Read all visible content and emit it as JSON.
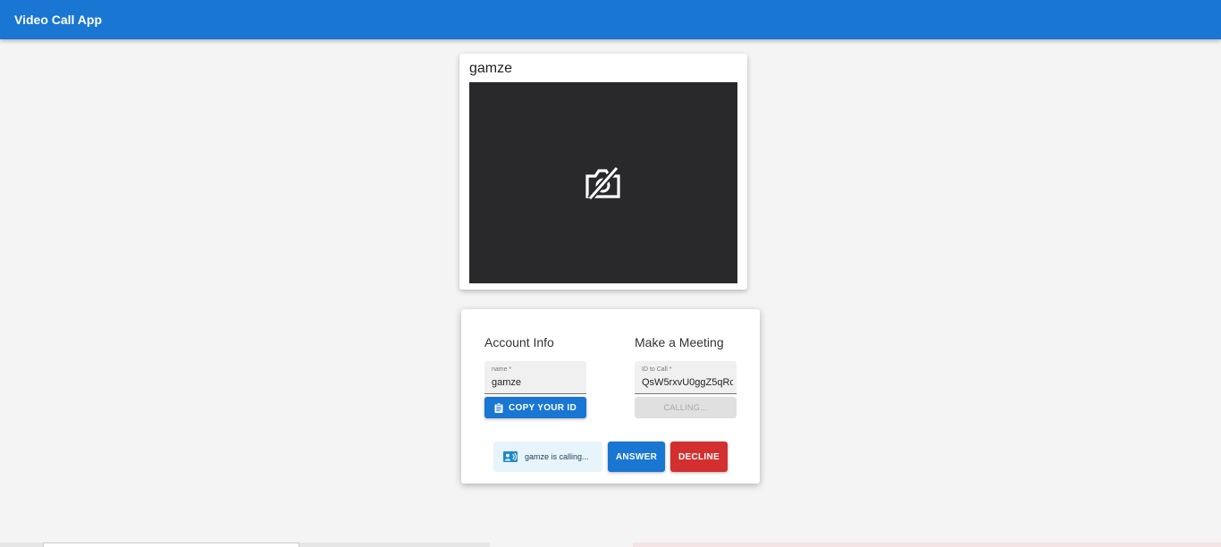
{
  "appbar": {
    "title": "Video Call App",
    "color": "#1976d2"
  },
  "video": {
    "name": "gamze",
    "camera_icon": "videocam-off-icon"
  },
  "account": {
    "title": "Account Info",
    "name_label": "name *",
    "name_value": "gamze",
    "copy_label": "COPY YOUR ID",
    "copy_icon": "clipboard-icon"
  },
  "meeting": {
    "title": "Make a Meeting",
    "id_label": "ID to Call *",
    "id_value": "QsW5rxvU0ggZ5qRc",
    "calling_label": "CALLING..."
  },
  "incoming": {
    "text": "gamze is calling...",
    "icon": "contact-card-icon",
    "answer_label": "ANSWER",
    "decline_label": "DECLINE",
    "answer_color": "#1976d2",
    "decline_color": "#d32f2f"
  }
}
